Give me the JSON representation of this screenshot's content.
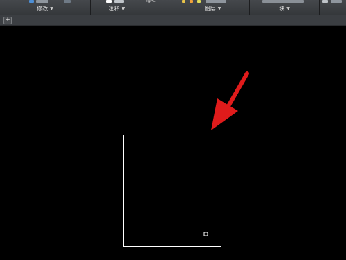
{
  "ribbon": {
    "panels": [
      {
        "title": "修改",
        "partial_label": "",
        "top_icons": [
          "#4d8fd6",
          "#9aa3ad"
        ]
      },
      {
        "title": "注释",
        "partial_label": "",
        "top_icons": [
          "#ffffff",
          "#bfc4c9"
        ]
      },
      {
        "title": "",
        "partial_label": "特性",
        "top_icons": []
      },
      {
        "title": "图层",
        "partial_label": "",
        "top_icons": [
          "#e7c34a",
          "#f2a23a",
          "#e2df5a"
        ]
      },
      {
        "title": "块",
        "partial_label": "",
        "top_icons": [
          "#c7c7c7"
        ]
      }
    ],
    "dropdown_glyph": "▼"
  },
  "tabbar": {
    "add_tab_glyph": "+"
  },
  "drawing": {
    "background": "#000000",
    "line_color": "#ffffff",
    "annotation_color": "#e01b1b"
  },
  "colors": {
    "ribbon_bg": "#3a3d41",
    "ribbon_text": "#e6e6e6",
    "tabbar_bg": "#3b3e42"
  }
}
